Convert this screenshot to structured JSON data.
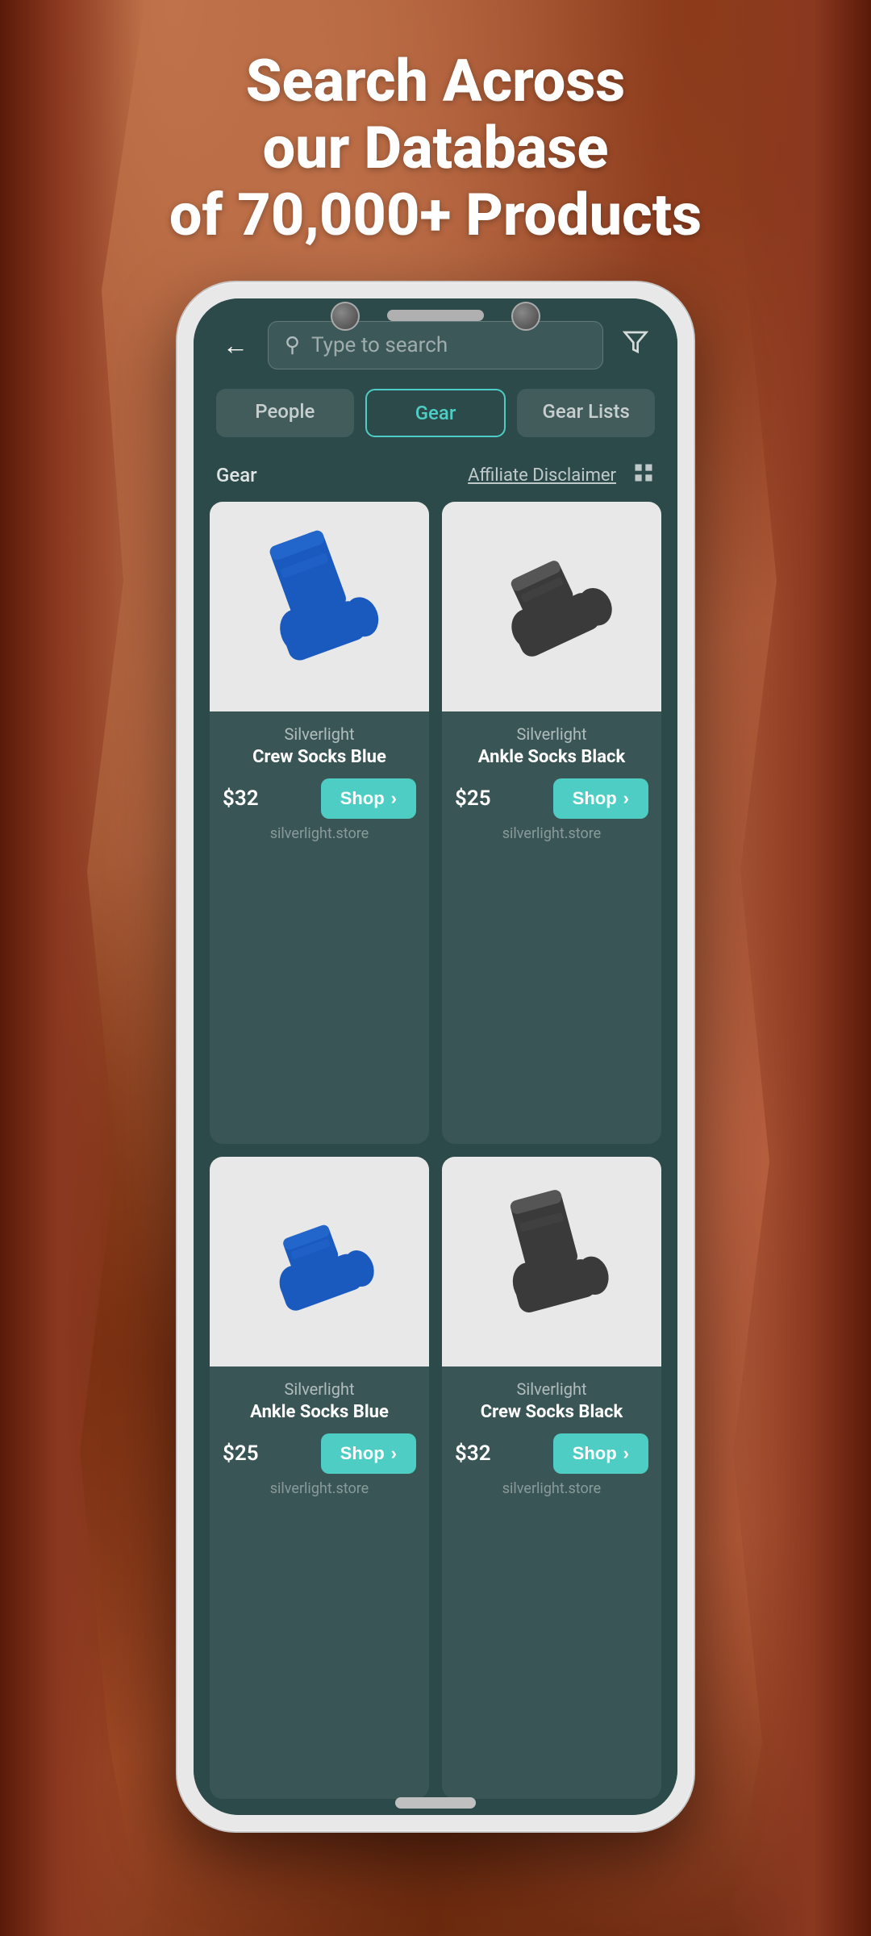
{
  "hero": {
    "line1": "Search Across",
    "line2": "our Database",
    "line3": "of 70,000+ Products"
  },
  "search": {
    "placeholder": "Type to search",
    "back_label": "←",
    "filter_label": "⊿"
  },
  "tabs": [
    {
      "id": "people",
      "label": "People",
      "active": false
    },
    {
      "id": "gear",
      "label": "Gear",
      "active": true
    },
    {
      "id": "gear-lists",
      "label": "Gear Lists",
      "active": false
    }
  ],
  "section": {
    "label": "Gear",
    "affiliate_label": "Affiliate Disclaimer",
    "grid_icon": "▦"
  },
  "products": [
    {
      "brand": "Silverlight",
      "name": "Crew Socks Blue",
      "price": "$32",
      "store": "silverlight.store",
      "shop_label": "Shop",
      "color": "blue",
      "type": "crew"
    },
    {
      "brand": "Silverlight",
      "name": "Ankle Socks Black",
      "price": "$25",
      "store": "silverlight.store",
      "shop_label": "Shop",
      "color": "black",
      "type": "ankle"
    },
    {
      "brand": "Silverlight",
      "name": "Ankle Socks Blue",
      "price": "$25",
      "store": "silverlight.store",
      "shop_label": "Shop",
      "color": "blue",
      "type": "ankle"
    },
    {
      "brand": "Silverlight",
      "name": "Crew Socks Black",
      "price": "$32",
      "store": "silverlight.store",
      "shop_label": "Shop",
      "color": "black",
      "type": "crew"
    }
  ],
  "colors": {
    "teal": "#4ecdc4",
    "dark_bg": "#2d4a4a",
    "card_bg": "#3a5555"
  }
}
